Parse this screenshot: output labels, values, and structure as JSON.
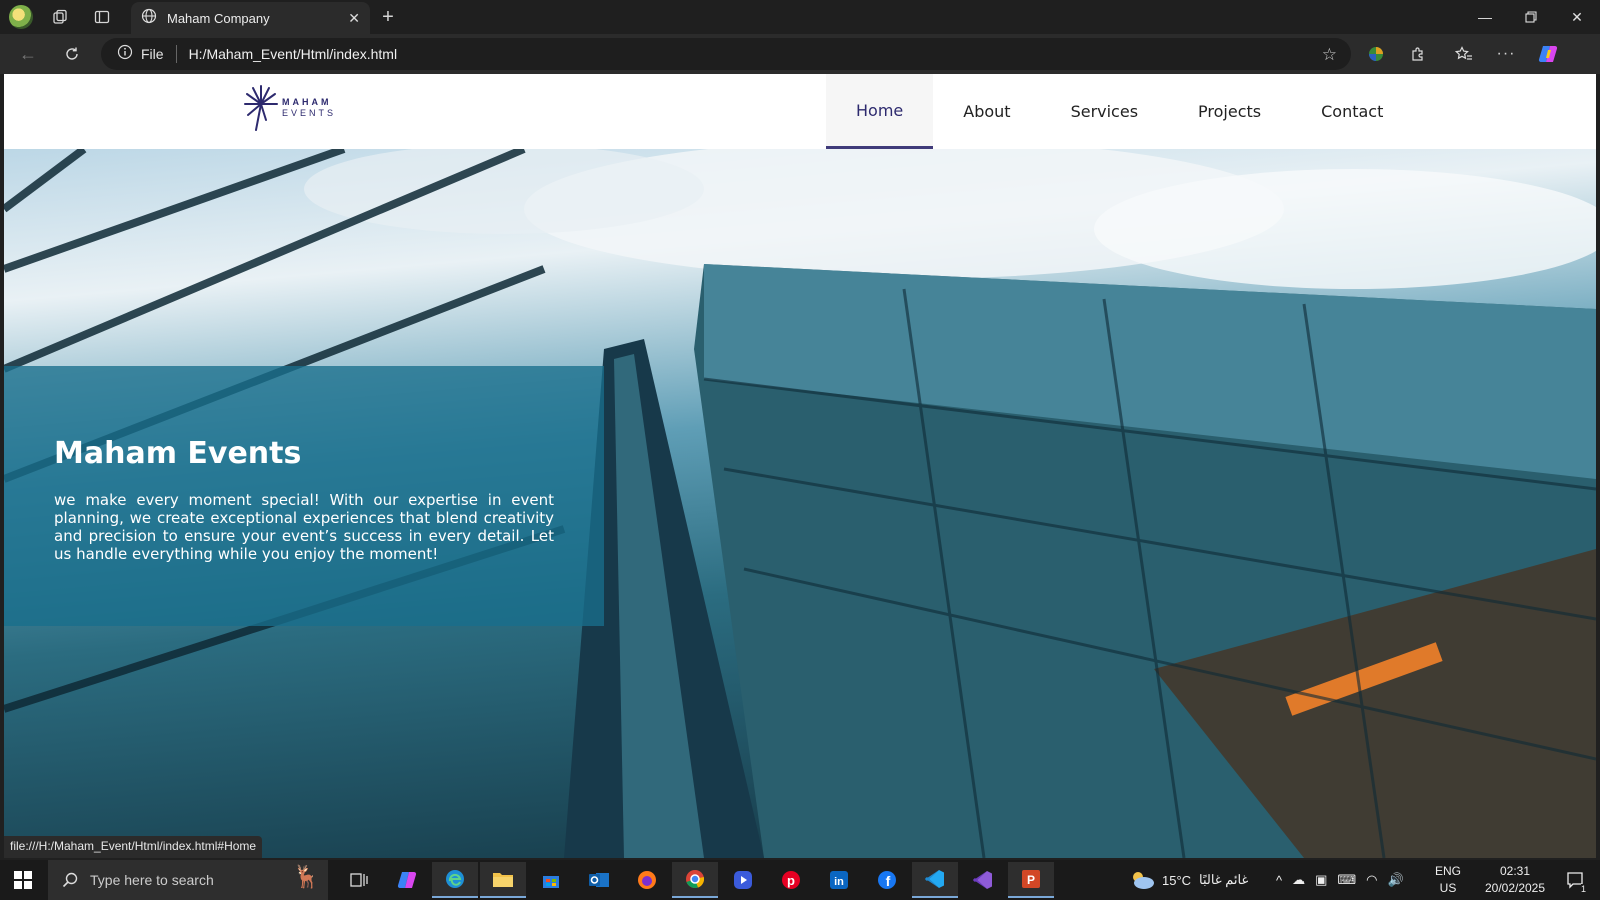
{
  "browser": {
    "tab_title": "Maham Company",
    "address_scheme": "File",
    "address_url": "H:/Maham_Event/Html/index.html",
    "status_url": "file:///H:/Maham_Event/Html/index.html#Home"
  },
  "site": {
    "logo_line1": "MAHAM",
    "logo_line2": "EVENTS",
    "nav": [
      {
        "label": "Home",
        "active": true
      },
      {
        "label": "About"
      },
      {
        "label": "Services"
      },
      {
        "label": "Projects"
      },
      {
        "label": "Contact"
      }
    ],
    "hero": {
      "title": "Maham Events",
      "text": "we make every moment special! With our expertise in event planning, we create exceptional experiences that blend creativity and precision to ensure your event’s success in every detail. Let us handle everything while you enjoy the moment!"
    }
  },
  "taskbar": {
    "search_placeholder": "Type here to search",
    "weather": "15°C",
    "weather_desc": "غائم غالبًا",
    "lang_line1": "ENG",
    "lang_line2": "US",
    "time": "02:31",
    "date": "20/02/2025",
    "notification_count": "1"
  },
  "colors": {
    "brand": "#2d2a6e",
    "hero_panel": "#186e8c"
  }
}
